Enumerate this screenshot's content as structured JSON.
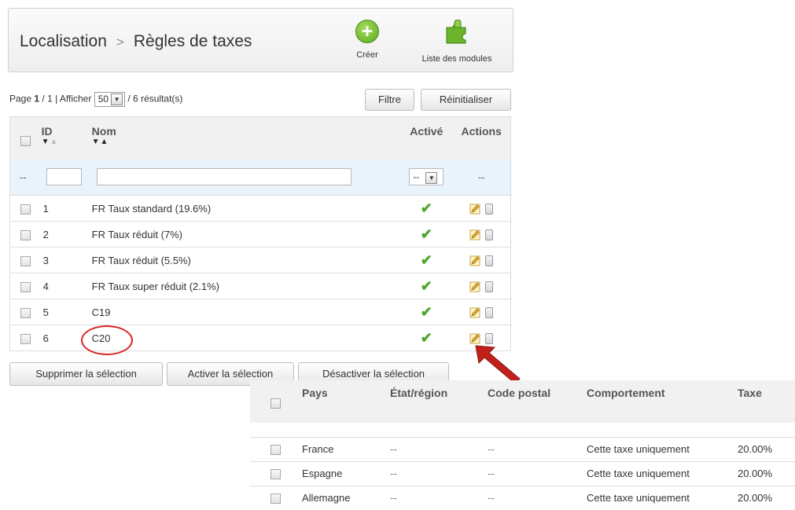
{
  "header": {
    "crumb1": "Localisation",
    "separator": ">",
    "crumb2": "Règles de taxes",
    "create_label": "Créer",
    "create_icon": "plus-circle-icon",
    "modules_label": "Liste des modules",
    "modules_icon": "puzzle-icon"
  },
  "pagination": {
    "page_prefix": "Page",
    "page_current": "1",
    "page_total_sep": "/ 1 | Afficher",
    "per_page": "50",
    "results": "/ 6 résultat(s)"
  },
  "buttons": {
    "filter": "Filtre",
    "reset": "Réinitialiser",
    "delete_sel": "Supprimer la sélection",
    "activate_sel": "Activer la sélection",
    "deactivate_sel": "Désactiver la sélection"
  },
  "table": {
    "headers": {
      "id": "ID",
      "name": "Nom",
      "active": "Activé",
      "actions": "Actions"
    },
    "filter_placeholder_left": "--",
    "filter_active_value": "--",
    "filter_actions": "--",
    "rows": [
      {
        "id": "1",
        "name": "FR Taux standard (19.6%)"
      },
      {
        "id": "2",
        "name": "FR Taux réduit (7%)"
      },
      {
        "id": "3",
        "name": "FR Taux réduit (5.5%)"
      },
      {
        "id": "4",
        "name": "FR Taux super réduit (2.1%)"
      },
      {
        "id": "5",
        "name": "C19"
      },
      {
        "id": "6",
        "name": "C20"
      }
    ],
    "active_icon": "check-icon",
    "edit_icon": "pencil-icon",
    "delete_icon": "trash-icon"
  },
  "overlay": {
    "headers": {
      "country": "Pays",
      "region": "État/région",
      "zip": "Code postal",
      "behavior": "Comportement",
      "tax": "Taxe"
    },
    "rows": [
      {
        "country": "France",
        "region": "--",
        "zip": "--",
        "behavior": "Cette taxe uniquement",
        "tax": "20.00%"
      },
      {
        "country": "Espagne",
        "region": "--",
        "zip": "--",
        "behavior": "Cette taxe uniquement",
        "tax": "20.00%"
      },
      {
        "country": "Allemagne",
        "region": "--",
        "zip": "--",
        "behavior": "Cette taxe uniquement",
        "tax": "20.00%"
      }
    ]
  },
  "colors": {
    "check": "#52a52b",
    "annotation": "#cc2222",
    "accent_green": "#6cb52a"
  }
}
